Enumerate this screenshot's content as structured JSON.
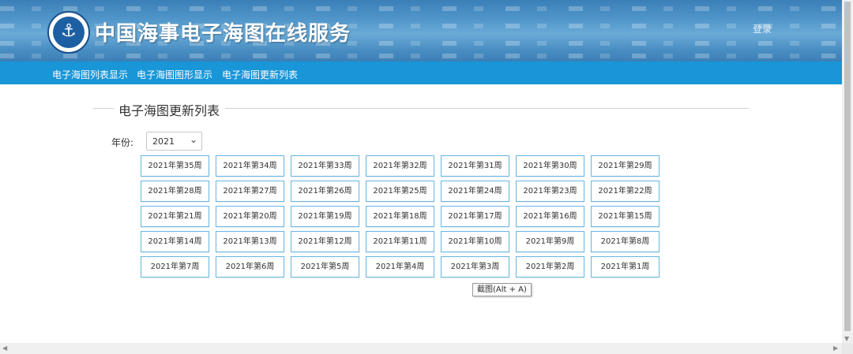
{
  "header": {
    "site_title": "中国海事电子海图在线服务",
    "logo_icon": "china-msa-anchor-logo",
    "login_label": "登录"
  },
  "nav": {
    "items": [
      {
        "label": "电子海图列表显示"
      },
      {
        "label": "电子海图图形显示"
      },
      {
        "label": "电子海图更新列表"
      }
    ]
  },
  "section": {
    "title": "电子海图更新列表"
  },
  "year": {
    "label": "年份:",
    "selected": "2021"
  },
  "weeks": [
    "2021年第35周",
    "2021年第34周",
    "2021年第33周",
    "2021年第32周",
    "2021年第31周",
    "2021年第30周",
    "2021年第29周",
    "2021年第28周",
    "2021年第27周",
    "2021年第26周",
    "2021年第25周",
    "2021年第24周",
    "2021年第23周",
    "2021年第22周",
    "2021年第21周",
    "2021年第20周",
    "2021年第19周",
    "2021年第18周",
    "2021年第17周",
    "2021年第16周",
    "2021年第15周",
    "2021年第14周",
    "2021年第13周",
    "2021年第12周",
    "2021年第11周",
    "2021年第10周",
    "2021年第9周",
    "2021年第8周",
    "2021年第7周",
    "2021年第6周",
    "2021年第5周",
    "2021年第4周",
    "2021年第3周",
    "2021年第2周",
    "2021年第1周"
  ],
  "tooltip": {
    "text": "截图(Alt + A)"
  },
  "colors": {
    "nav_bar": "#1896d8",
    "button_border": "#67b6e3"
  }
}
